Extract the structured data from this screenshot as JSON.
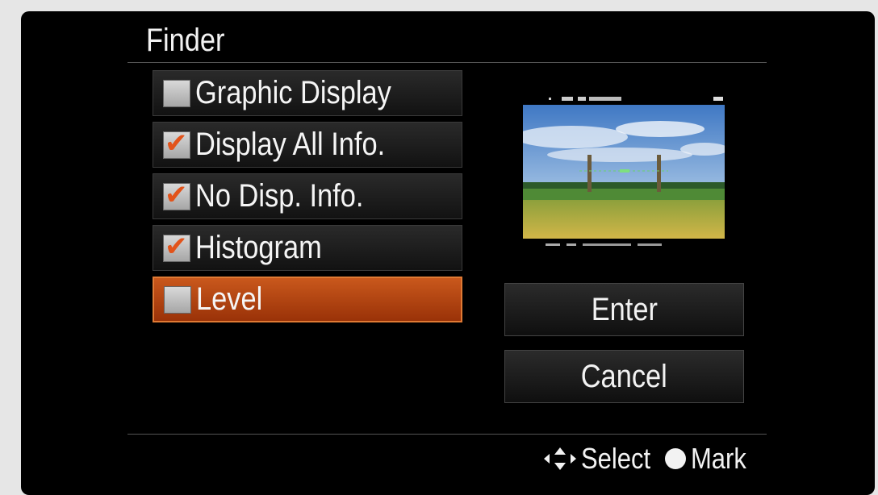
{
  "title": "Finder",
  "options": [
    {
      "label": "Graphic Display",
      "checked": false,
      "selected": false
    },
    {
      "label": "Display All Info.",
      "checked": true,
      "selected": false
    },
    {
      "label": "No Disp. Info.",
      "checked": true,
      "selected": false
    },
    {
      "label": "Histogram",
      "checked": true,
      "selected": false
    },
    {
      "label": "Level",
      "checked": false,
      "selected": true
    }
  ],
  "checkmark_glyph": "✔",
  "buttons": {
    "enter": "Enter",
    "cancel": "Cancel"
  },
  "footer": {
    "select_label": "Select",
    "mark_label": "Mark"
  },
  "colors": {
    "selected_bg": "#b5450f",
    "checkmark": "#e2531a",
    "background": "#000000"
  }
}
